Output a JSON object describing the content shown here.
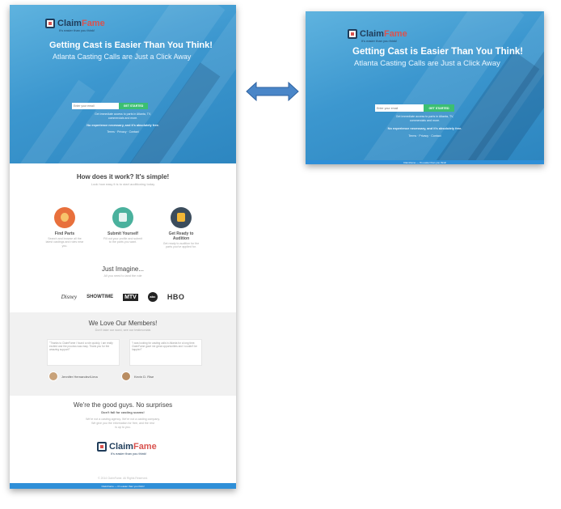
{
  "brand": {
    "name_part1": "Claim",
    "name_part2": "Fame",
    "tagline": "It's easier than you think!"
  },
  "hero": {
    "headline": "Getting Cast is Easier Than You Think!",
    "subheadline": "Atlanta Casting Calls are Just a Click Away",
    "email_placeholder": "Enter your email",
    "cta_label": "GET STARTED",
    "info_line1": "Get immediate access to parts in Atlanta, TV,",
    "info_line2": "commercials and more.",
    "bold_line": "No experience necessary, and it's absolutely free.",
    "links": "Terms · Privacy · Contact"
  },
  "how": {
    "title": "How does it work? It's simple!",
    "subtitle": "Look how easy it is to start auditioning today",
    "steps": [
      {
        "title": "Find Parts",
        "desc": "Search and browse all the latest castings and roles near you."
      },
      {
        "title": "Submit Yourself",
        "desc": "Fill out your profile and submit to the parts you want."
      },
      {
        "title": "Get Ready to Audition",
        "desc": "Get ready to audition for the parts you've applied for."
      }
    ]
  },
  "imagine": {
    "title": "Just Imagine...",
    "subtitle": "All you need to land the role",
    "brands": [
      "Disney",
      "SHOWTIME",
      "MTV",
      "abc",
      "HBO"
    ]
  },
  "members": {
    "title": "We Love Our Members!",
    "subtitle": "Don't take our word, see our testimonials",
    "testimonials": [
      {
        "text": "\"Thanks to ClaimFame I found a role quickly. I am really excited and the process was easy. Thank you for the amazing support!\"",
        "author": "Jennifer Hernandez/Lima"
      },
      {
        "text": "\"I was looking for casting calls in Atlanta for a long time. ClaimFame gave me great opportunities and I couldn't be happier!\"",
        "author": "Kevin D. Rise"
      }
    ]
  },
  "goodguys": {
    "title": "We're the good guys. No surprises",
    "subtitle": "Don't fall for casting scams!",
    "body_line1": "We're not a casting agency. We're not a casting company.",
    "body_line2": "We give you the information for free, and the rest",
    "body_line3": "is up to you."
  },
  "footer": {
    "copyright": "© 2014 ClaimFame. All Rights Reserved.",
    "bar_text": "ClaimFame — It's easier than you think!"
  },
  "colors": {
    "hero_blue": "#3c97cf",
    "cta_green": "#3cbf72",
    "arrow_blue": "#4a86c8",
    "logo_red": "#d9534f",
    "bar_blue": "#2f8fd8"
  },
  "icons": {
    "arrow": "double-headed-arrow-icon"
  }
}
